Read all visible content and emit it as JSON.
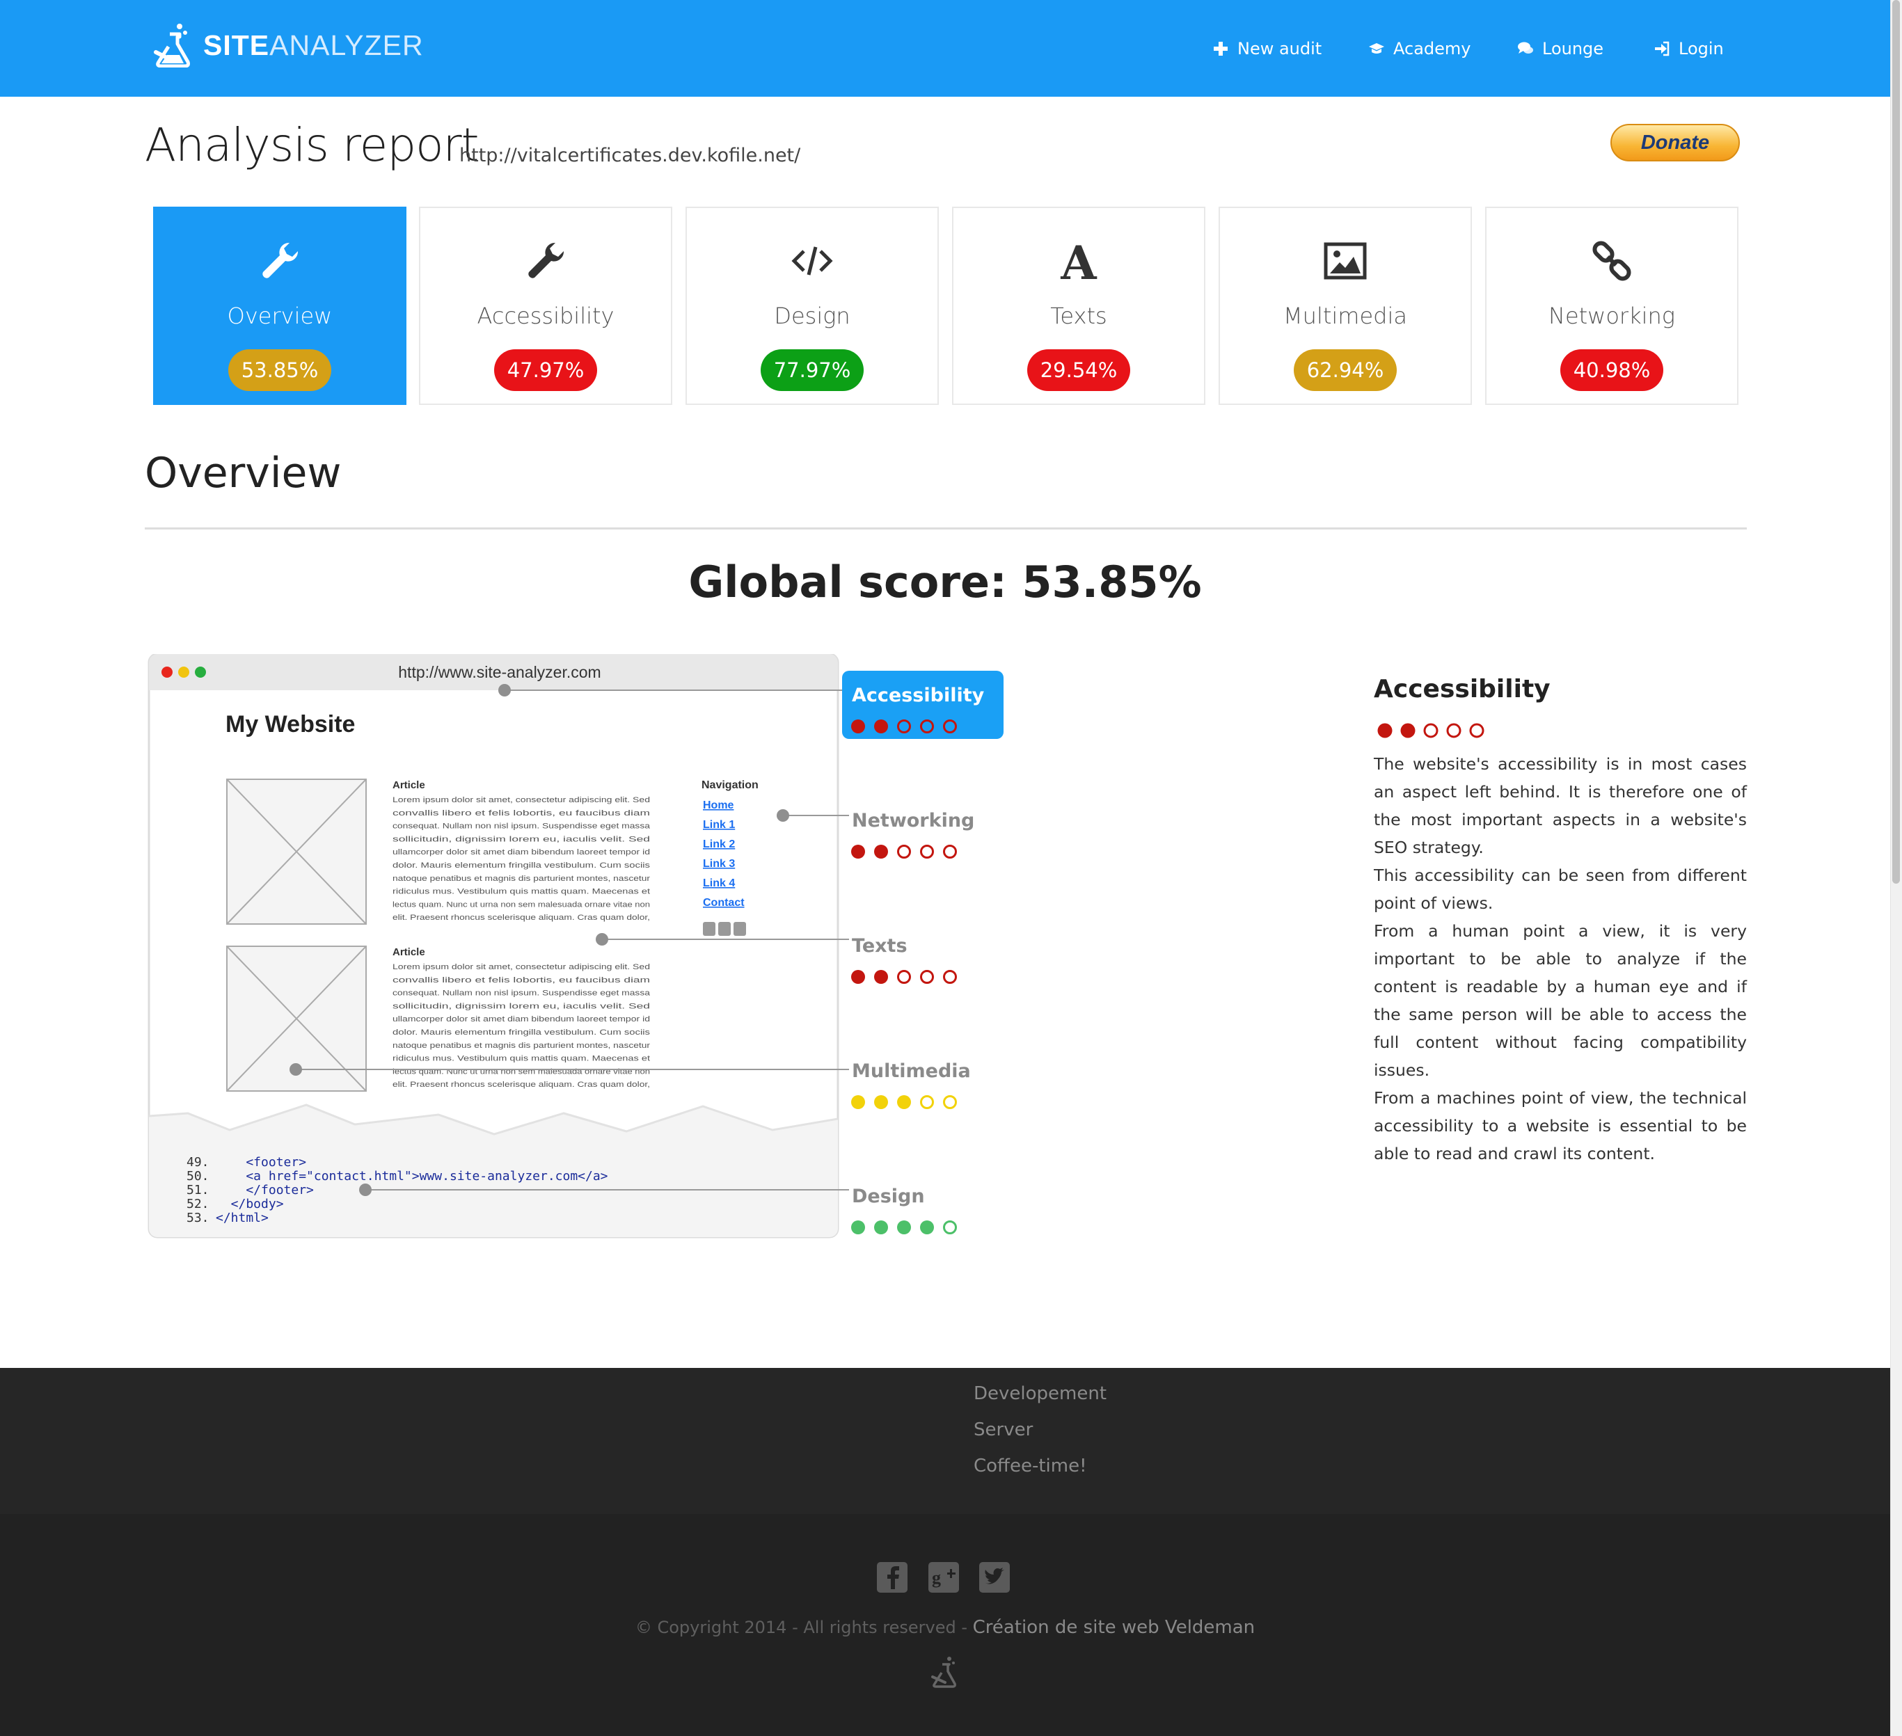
{
  "header": {
    "logo": {
      "site": "SITE",
      "analyzer": "ANALYZER"
    },
    "nav": [
      {
        "label": "New audit",
        "icon": "plus-icon"
      },
      {
        "label": "Academy",
        "icon": "graduation-cap-icon"
      },
      {
        "label": "Lounge",
        "icon": "comments-icon"
      },
      {
        "label": "Login",
        "icon": "sign-in-icon"
      }
    ]
  },
  "report": {
    "title": "Analysis report",
    "url": "http://vitalcertificates.dev.kofile.net/",
    "donate_label": "Donate"
  },
  "categories": [
    {
      "label": "Overview",
      "score": "53.85%",
      "score_color": "#d4a017",
      "icon": "wrench-icon",
      "active": true
    },
    {
      "label": "Accessibility",
      "score": "47.97%",
      "score_color": "#e81318",
      "icon": "wrench-icon",
      "active": false
    },
    {
      "label": "Design",
      "score": "77.97%",
      "score_color": "#0ca016",
      "icon": "code-icon",
      "active": false
    },
    {
      "label": "Texts",
      "score": "29.54%",
      "score_color": "#e81318",
      "icon": "font-icon",
      "active": false
    },
    {
      "label": "Multimedia",
      "score": "62.94%",
      "score_color": "#d4a017",
      "icon": "picture-icon",
      "active": false
    },
    {
      "label": "Networking",
      "score": "40.98%",
      "score_color": "#e81318",
      "icon": "link-icon",
      "active": false
    }
  ],
  "overview": {
    "section_title": "Overview",
    "global_score": "Global score: 53.85%"
  },
  "illustration": {
    "browser_url": "http://www.site-analyzer.com",
    "site_title": "My Website",
    "article_heading": "Article",
    "lorem": "Lorem ipsum dolor sit amet, consectetur adipiscing elit. Sed convallis libero et felis lobortis, eu faucibus diam consequat. Nullam non nisl ipsum. Suspendisse eget massa sollicitudin, dignissim lorem eu, iaculis velit. Sed ullamcorper dolor sit amet diam bibendum laoreet tempor id dolor. Mauris elementum fringilla vestibulum. Cum sociis natoque penatibus et magnis dis parturient montes, nascetur ridiculus mus. Vestibulum quis mattis quam. Maecenas et lectus quam. Nunc ut urna non sem malesuada ornare vitae non elit. Praesent rhoncus scelerisque aliquam. Cras quam dolor, porta ac dapibus nec, fermentum eget velit. Nullam non nisi vitae erat sodales aliquam semper at quam.",
    "nav_heading": "Navigation",
    "nav_links": [
      "Home",
      "Link 1",
      "Link 2",
      "Link 3",
      "Link 4",
      "Contact"
    ],
    "code_lines": [
      {
        "num": "49.",
        "text": "    <footer>"
      },
      {
        "num": "50.",
        "text": "    <a href=\"contact.html\">www.site-analyzer.com</a>"
      },
      {
        "num": "51.",
        "text": "    </footer>"
      },
      {
        "num": "52.",
        "text": "  </body>"
      },
      {
        "num": "53.",
        "text": "</html>"
      }
    ],
    "callouts": [
      {
        "label": "Accessibility",
        "rating": 2,
        "color": "#c3160f",
        "highlight": true
      },
      {
        "label": "Networking",
        "rating": 2,
        "color": "#c3160f",
        "highlight": false
      },
      {
        "label": "Texts",
        "rating": 2,
        "color": "#c3160f",
        "highlight": false
      },
      {
        "label": "Multimedia",
        "rating": 3,
        "color": "#f2d20a",
        "highlight": false
      },
      {
        "label": "Design",
        "rating": 4,
        "color": "#4cc069",
        "highlight": false
      }
    ]
  },
  "description": {
    "title": "Accessibility",
    "rating": 2,
    "rating_color": "#c3160f",
    "paragraphs": [
      "The website's accessibility is in most cases an aspect left behind. It is therefore one of the most important aspects in a website's SEO strategy.",
      "This accessibility can be seen from different point of views.",
      "From a human point a view, it is very important to be able to analyze if the content is readable by a human eye and if the same person will be able to access the full content without facing compatibility issues.",
      "From a machines point of view, the technical accessibility to a website is essential to be able to read and crawl its content."
    ]
  },
  "footer": {
    "links": [
      "Developement",
      "Server",
      "Coffee-time!"
    ],
    "social": [
      "facebook-icon",
      "google-plus-icon",
      "twitter-icon"
    ],
    "copyright": "© Copyright 2014 - All rights reserved - ",
    "credit": "Création de site web Veldeman"
  }
}
